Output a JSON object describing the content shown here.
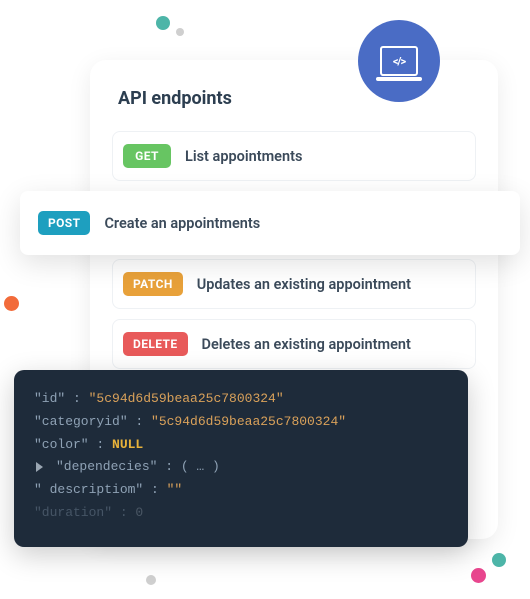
{
  "decorations": {
    "badge_icon": "laptop-code-icon"
  },
  "panel": {
    "title": "API endpoints",
    "endpoints": [
      {
        "method": "GET",
        "label": "List appointments"
      },
      {
        "method": "POST",
        "label": "Create an appointments"
      },
      {
        "method": "PATCH",
        "label": "Updates an existing appointment"
      },
      {
        "method": "DELETE",
        "label": "Deletes an existing appointment"
      }
    ]
  },
  "code": {
    "lines": [
      {
        "key": "\"id\"",
        "value": "\"5c94d6d59beaa25c7800324\"",
        "type": "str"
      },
      {
        "key": "\"categoryid\"",
        "value": "\"5c94d6d59beaa25c7800324\"",
        "type": "str"
      },
      {
        "key": "\"color\"",
        "value": "NULL",
        "type": "null"
      },
      {
        "key": "\"dependecies\"",
        "value": "( … )",
        "type": "obj",
        "nested": true
      },
      {
        "key": "\" descriptiom\"",
        "value": "\"\"",
        "type": "str"
      },
      {
        "key": "\"duration\"",
        "value": "0",
        "type": "num",
        "fade": true
      }
    ]
  },
  "colors": {
    "get": "#67c562",
    "post": "#1e9fbf",
    "patch": "#e8a13a",
    "delete": "#e85a5a",
    "badge": "#4a6cc5",
    "code_bg": "#1e2b3a"
  }
}
